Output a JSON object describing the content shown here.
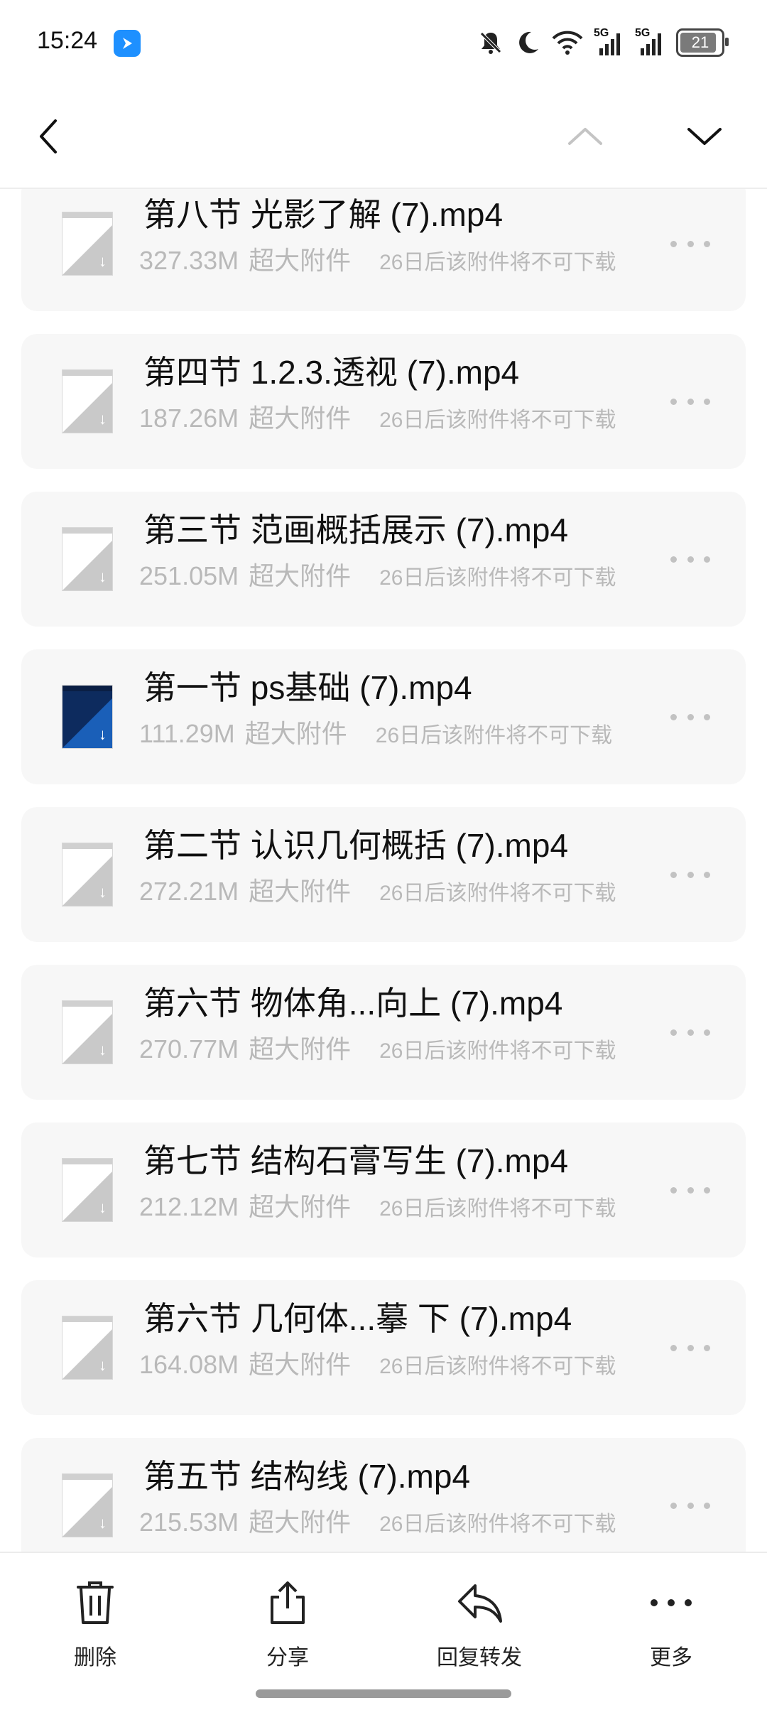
{
  "status_bar": {
    "time": "15:24",
    "signal1_label": "5G",
    "signal2_label": "5G",
    "battery": "21",
    "icons": [
      "app-badge-icon",
      "mute-bell-icon",
      "moon-icon",
      "wifi-icon",
      "signal-5g-icon",
      "signal-5g-icon",
      "battery-icon"
    ]
  },
  "header": {
    "icons": [
      "back-chevron-icon",
      "chevron-up-icon",
      "chevron-down-icon"
    ]
  },
  "attachments": [
    {
      "name": "第八节 光影了解 (7).mp4",
      "size": "327.33M",
      "tag": "超大附件",
      "note": "26日后该附件将不可下载",
      "thumb": "light"
    },
    {
      "name": "第四节 1.2.3.透视 (7).mp4",
      "size": "187.26M",
      "tag": "超大附件",
      "note": "26日后该附件将不可下载",
      "thumb": "light"
    },
    {
      "name": "第三节 范画概括展示 (7).mp4",
      "size": "251.05M",
      "tag": "超大附件",
      "note": "26日后该附件将不可下载",
      "thumb": "light"
    },
    {
      "name": "第一节 ps基础 (7).mp4",
      "size": "111.29M",
      "tag": "超大附件",
      "note": "26日后该附件将不可下载",
      "thumb": "blue"
    },
    {
      "name": "第二节 认识几何概括 (7).mp4",
      "size": "272.21M",
      "tag": "超大附件",
      "note": "26日后该附件将不可下载",
      "thumb": "light"
    },
    {
      "name": "第六节 物体角...向上 (7).mp4",
      "size": "270.77M",
      "tag": "超大附件",
      "note": "26日后该附件将不可下载",
      "thumb": "light"
    },
    {
      "name": "第七节 结构石膏写生 (7).mp4",
      "size": "212.12M",
      "tag": "超大附件",
      "note": "26日后该附件将不可下载",
      "thumb": "light"
    },
    {
      "name": "第六节 几何体...摹 下 (7).mp4",
      "size": "164.08M",
      "tag": "超大附件",
      "note": "26日后该附件将不可下载",
      "thumb": "light"
    },
    {
      "name": "第五节 结构线 (7).mp4",
      "size": "215.53M",
      "tag": "超大附件",
      "note": "26日后该附件将不可下载",
      "thumb": "light"
    }
  ],
  "toolbar": {
    "delete_label": "删除",
    "share_label": "分享",
    "reply_forward_label": "回复转发",
    "more_label": "更多"
  },
  "colors": {
    "accent": "#1e90ff",
    "card_bg": "#f7f7f7",
    "meta_text": "#b9b9b9"
  }
}
